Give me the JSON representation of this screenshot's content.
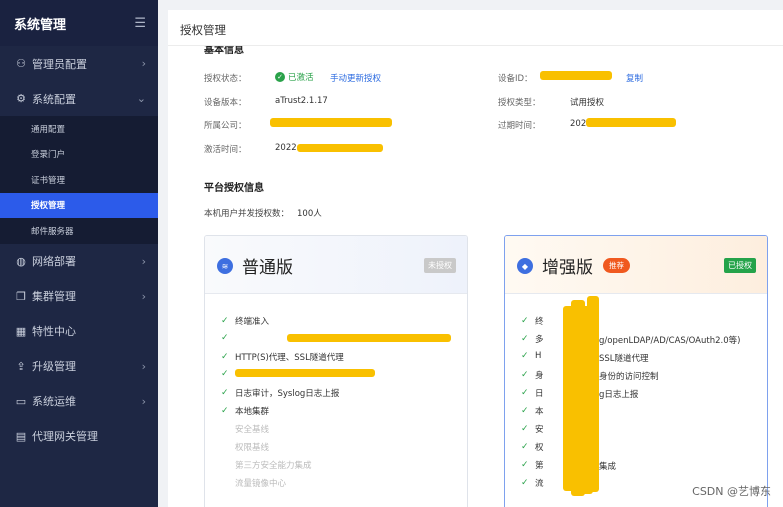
{
  "sidebar": {
    "title": "系统管理",
    "collapse_icon": "menu-collapse-icon",
    "items": [
      {
        "label": "管理员配置",
        "icon": "user-icon"
      },
      {
        "label": "系统配置",
        "icon": "gear-icon"
      },
      {
        "label": "网络部署",
        "icon": "globe-icon"
      },
      {
        "label": "集群管理",
        "icon": "cluster-icon"
      },
      {
        "label": "特性中心",
        "icon": "grid-icon"
      },
      {
        "label": "升级管理",
        "icon": "upload-icon"
      },
      {
        "label": "系统运维",
        "icon": "monitor-icon"
      },
      {
        "label": "代理网关管理",
        "icon": "gateway-icon"
      }
    ],
    "subitems": [
      "通用配置",
      "登录门户",
      "证书管理",
      "授权管理",
      "邮件服务器"
    ]
  },
  "page": {
    "title": "授权管理",
    "basic_section_title": "基本信息",
    "platform_section_title": "平台授权信息"
  },
  "basic": {
    "status_label": "授权状态：",
    "status_value": "已激活",
    "status_action": "手动更新授权",
    "version_label": "设备版本：",
    "version_value": "aTrust2.1.17",
    "company_label": "所属公司：",
    "activated_label": "激活时间：",
    "activated_value": "2022",
    "device_id_label": "设备ID：",
    "copy_label": "复制",
    "auth_type_label": "授权类型：",
    "auth_type_value": "试用授权",
    "expire_label": "过期时间：",
    "expire_value": "202"
  },
  "platform": {
    "concurrency_label": "本机用户并发授权数：",
    "concurrency_value": "100人"
  },
  "cards": {
    "standard": {
      "name": "普通版",
      "badge": "未授权",
      "features_on": [
        "终端准入",
        "HTTP(S)代理、SSL隧道代理",
        "日志审计，Syslog日志上报",
        "本地集群"
      ],
      "features_off": [
        "安全基线",
        "权限基线",
        "第三方安全能力集成",
        "流量镜像中心"
      ]
    },
    "enhanced": {
      "name": "增强版",
      "pill": "推荐",
      "badge": "已授权",
      "fragments": [
        "终",
        "多",
        "g/openLDAP/AD/CAS/OAuth2.0等)",
        "H",
        "SSL隧道代理",
        "身",
        "身份的访问控制",
        "日",
        "g日志上报",
        "本",
        "安",
        "权",
        "第",
        "集成",
        "流"
      ]
    }
  },
  "colors": {
    "sidebar_bg": "#1e2744",
    "active": "#2c5bea",
    "success": "#2aa24a",
    "link": "#2c6be0",
    "redaction": "#f9c000",
    "recommend": "#f0591f"
  },
  "watermark": "CSDN @艺博东"
}
